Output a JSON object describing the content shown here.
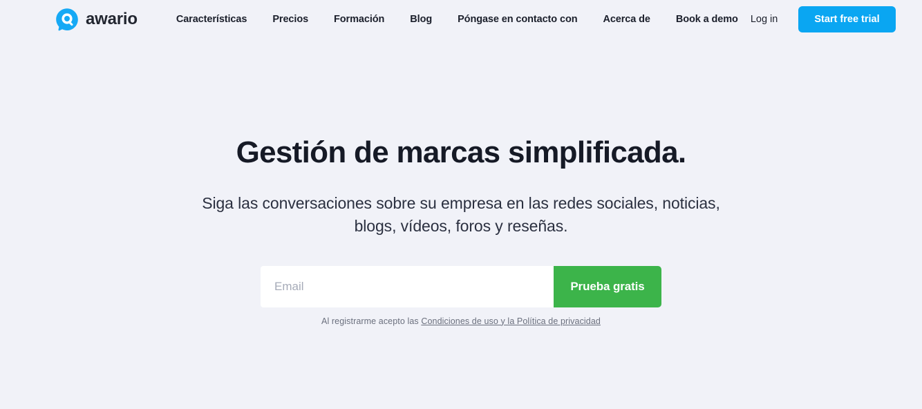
{
  "theme": {
    "page_background": "#f1f2f8",
    "accent_blue": "#0aa6f2",
    "accent_green": "#3cb44a",
    "text_dark": "#161a26",
    "text_muted": "#6a6f7d"
  },
  "header": {
    "logo": {
      "icon": "awario-speech-bubble-search-logo",
      "name": "awario"
    },
    "nav": [
      {
        "label": "Características"
      },
      {
        "label": "Precios"
      },
      {
        "label": "Formación"
      },
      {
        "label": "Blog"
      },
      {
        "label": "Póngase en contacto con"
      },
      {
        "label": "Acerca de"
      },
      {
        "label": "Book a demo"
      }
    ],
    "login_label": "Log in",
    "trial_button_label": "Start free trial"
  },
  "hero": {
    "title": "Gestión de marcas simplificada.",
    "subtitle": "Siga las conversaciones sobre su empresa en las redes sociales, noticias, blogs, vídeos, foros y reseñas.",
    "form": {
      "email_placeholder": "Email",
      "email_value": "",
      "submit_label": "Prueba gratis"
    },
    "legal": {
      "prefix": "Al registrarme acepto las ",
      "link_text": "Condiciones de uso y la Política de privacidad"
    }
  }
}
